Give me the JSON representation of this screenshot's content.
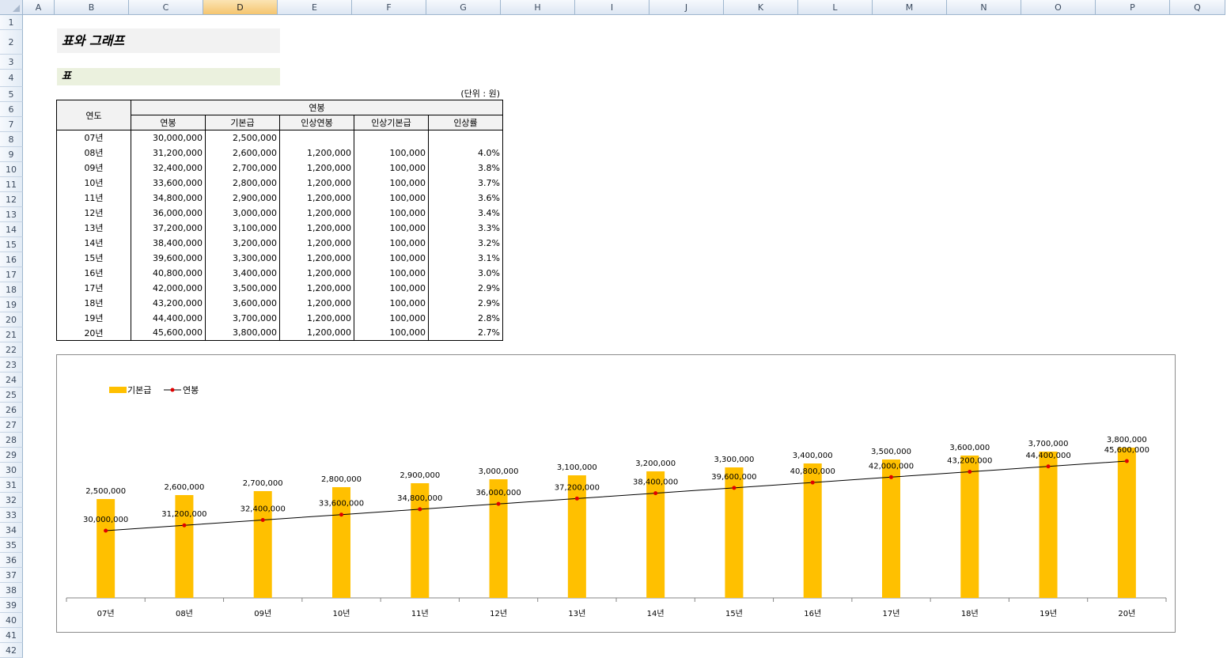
{
  "sheet": {
    "columns": [
      "A",
      "B",
      "C",
      "D",
      "E",
      "F",
      "G",
      "H",
      "I",
      "J",
      "K",
      "L",
      "M",
      "N",
      "O",
      "P",
      "Q"
    ],
    "selected_column": "D",
    "rows": [
      "1",
      "2",
      "3",
      "4",
      "5",
      "6",
      "7",
      "8",
      "9",
      "10",
      "11",
      "12",
      "13",
      "14",
      "15",
      "16",
      "17",
      "18",
      "19",
      "20",
      "21",
      "22",
      "23",
      "24",
      "25",
      "26",
      "27",
      "28",
      "29",
      "30",
      "31",
      "32",
      "33",
      "34",
      "35",
      "36",
      "37",
      "38",
      "39",
      "40",
      "41",
      "42"
    ]
  },
  "title": "표와 그래프",
  "section": "표",
  "unit_note": "(단위 : 원)",
  "table": {
    "header_year": "연도",
    "header_group": "연봉",
    "subheaders": [
      "연봉",
      "기본급",
      "인상연봉",
      "인상기본급",
      "인상률"
    ],
    "rows": [
      {
        "year": "07년",
        "salary": "30,000,000",
        "base": "2,500,000",
        "raise_salary": "",
        "raise_base": "",
        "rate": ""
      },
      {
        "year": "08년",
        "salary": "31,200,000",
        "base": "2,600,000",
        "raise_salary": "1,200,000",
        "raise_base": "100,000",
        "rate": "4.0%"
      },
      {
        "year": "09년",
        "salary": "32,400,000",
        "base": "2,700,000",
        "raise_salary": "1,200,000",
        "raise_base": "100,000",
        "rate": "3.8%"
      },
      {
        "year": "10년",
        "salary": "33,600,000",
        "base": "2,800,000",
        "raise_salary": "1,200,000",
        "raise_base": "100,000",
        "rate": "3.7%"
      },
      {
        "year": "11년",
        "salary": "34,800,000",
        "base": "2,900,000",
        "raise_salary": "1,200,000",
        "raise_base": "100,000",
        "rate": "3.6%"
      },
      {
        "year": "12년",
        "salary": "36,000,000",
        "base": "3,000,000",
        "raise_salary": "1,200,000",
        "raise_base": "100,000",
        "rate": "3.4%"
      },
      {
        "year": "13년",
        "salary": "37,200,000",
        "base": "3,100,000",
        "raise_salary": "1,200,000",
        "raise_base": "100,000",
        "rate": "3.3%"
      },
      {
        "year": "14년",
        "salary": "38,400,000",
        "base": "3,200,000",
        "raise_salary": "1,200,000",
        "raise_base": "100,000",
        "rate": "3.2%"
      },
      {
        "year": "15년",
        "salary": "39,600,000",
        "base": "3,300,000",
        "raise_salary": "1,200,000",
        "raise_base": "100,000",
        "rate": "3.1%"
      },
      {
        "year": "16년",
        "salary": "40,800,000",
        "base": "3,400,000",
        "raise_salary": "1,200,000",
        "raise_base": "100,000",
        "rate": "3.0%"
      },
      {
        "year": "17년",
        "salary": "42,000,000",
        "base": "3,500,000",
        "raise_salary": "1,200,000",
        "raise_base": "100,000",
        "rate": "2.9%"
      },
      {
        "year": "18년",
        "salary": "43,200,000",
        "base": "3,600,000",
        "raise_salary": "1,200,000",
        "raise_base": "100,000",
        "rate": "2.9%"
      },
      {
        "year": "19년",
        "salary": "44,400,000",
        "base": "3,700,000",
        "raise_salary": "1,200,000",
        "raise_base": "100,000",
        "rate": "2.8%"
      },
      {
        "year": "20년",
        "salary": "45,600,000",
        "base": "3,800,000",
        "raise_salary": "1,200,000",
        "raise_base": "100,000",
        "rate": "2.7%"
      }
    ]
  },
  "chart_data": {
    "type": "bar",
    "categories": [
      "07년",
      "08년",
      "09년",
      "10년",
      "11년",
      "12년",
      "13년",
      "14년",
      "15년",
      "16년",
      "17년",
      "18년",
      "19년",
      "20년"
    ],
    "series": [
      {
        "name": "기본급",
        "kind": "bar",
        "color": "#ffc000",
        "axis": "secondary",
        "values": [
          2500000,
          2600000,
          2700000,
          2800000,
          2900000,
          3000000,
          3100000,
          3200000,
          3300000,
          3400000,
          3500000,
          3600000,
          3700000,
          3800000
        ],
        "labels": [
          "2,500,000",
          "2,600,000",
          "2,700,000",
          "2,800,000",
          "2,900,000",
          "3,000,000",
          "3,100,000",
          "3,200,000",
          "3,300,000",
          "3,400,000",
          "3,500,000",
          "3,600,000",
          "3,700,000",
          "3,800,000"
        ]
      },
      {
        "name": "연봉",
        "kind": "line",
        "color": "#000000",
        "marker_color": "#e00000",
        "axis": "primary",
        "values": [
          30000000,
          31200000,
          32400000,
          33600000,
          34800000,
          36000000,
          37200000,
          38400000,
          39600000,
          40800000,
          42000000,
          43200000,
          44400000,
          45600000
        ],
        "labels": [
          "30,000,000",
          "31,200,000",
          "32,400,000",
          "33,600,000",
          "34,800,000",
          "36,000,000",
          "37,200,000",
          "38,400,000",
          "39,600,000",
          "40,800,000",
          "42,000,000",
          "43,200,000",
          "44,400,000",
          "45,600,000"
        ]
      }
    ],
    "legend_position": "top-left",
    "grid": false
  }
}
